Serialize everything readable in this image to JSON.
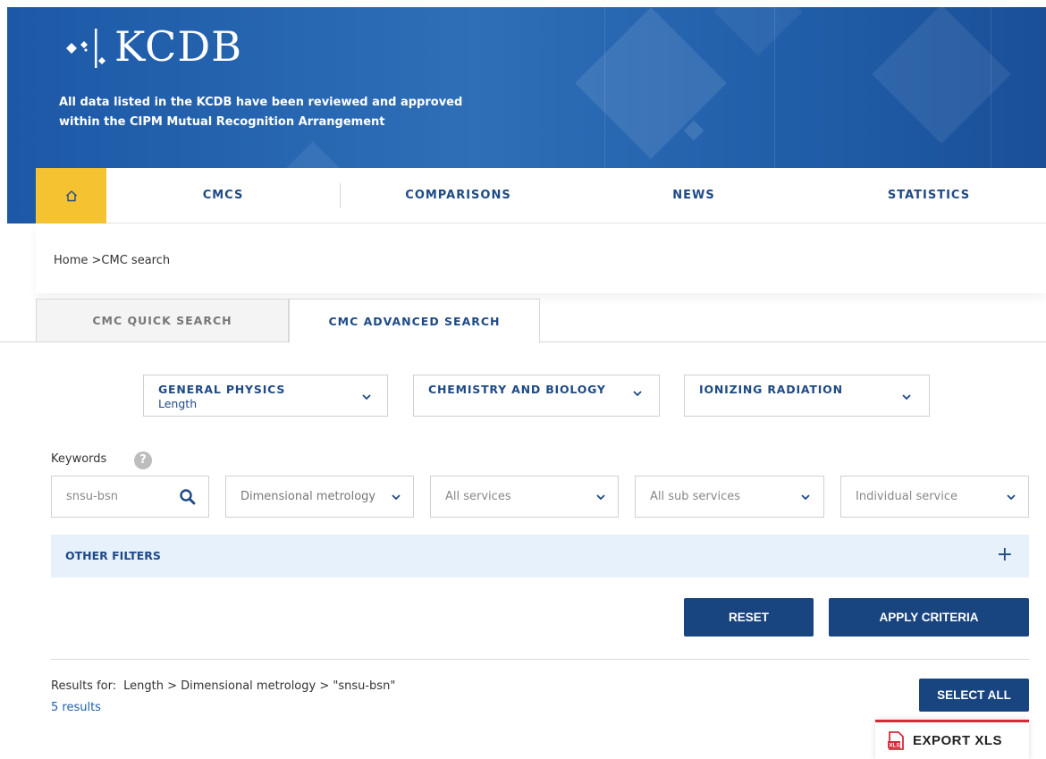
{
  "header": {
    "logo_text": "KCDB",
    "tagline_line1": "All data listed in the KCDB have been reviewed and approved",
    "tagline_line2": "within the CIPM Mutual Recognition Arrangement"
  },
  "nav": {
    "home_icon": "home-icon",
    "items": [
      "CMCS",
      "COMPARISONS",
      "NEWS",
      "STATISTICS"
    ]
  },
  "breadcrumb": "Home >CMC search",
  "tabs": {
    "quick": "CMC QUICK SEARCH",
    "advanced": "CMC ADVANCED SEARCH"
  },
  "domains": [
    {
      "title": "GENERAL PHYSICS",
      "selected": "Length"
    },
    {
      "title": "CHEMISTRY AND BIOLOGY",
      "selected": ""
    },
    {
      "title": "IONIZING RADIATION",
      "selected": ""
    }
  ],
  "keywords": {
    "label": "Keywords",
    "help": "?",
    "value": "snsu-bsn"
  },
  "filters": {
    "area": "Dimensional metrology",
    "service": "All services",
    "sub_service": "All sub services",
    "individual": "Individual service"
  },
  "other_filters": {
    "label": "OTHER FILTERS",
    "toggle": "+"
  },
  "buttons": {
    "reset": "RESET",
    "apply": "APPLY CRITERIA",
    "select_all": "SELECT ALL",
    "export": "EXPORT XLS"
  },
  "results": {
    "label": "Results for:",
    "criteria": "Length > Dimensional metrology > \"snsu-bsn\"",
    "count": "5 results"
  },
  "colors": {
    "brand_blue": "#1e4a86",
    "home_yellow": "#f5c331",
    "button_navy": "#18447f",
    "export_red": "#d22d37"
  }
}
